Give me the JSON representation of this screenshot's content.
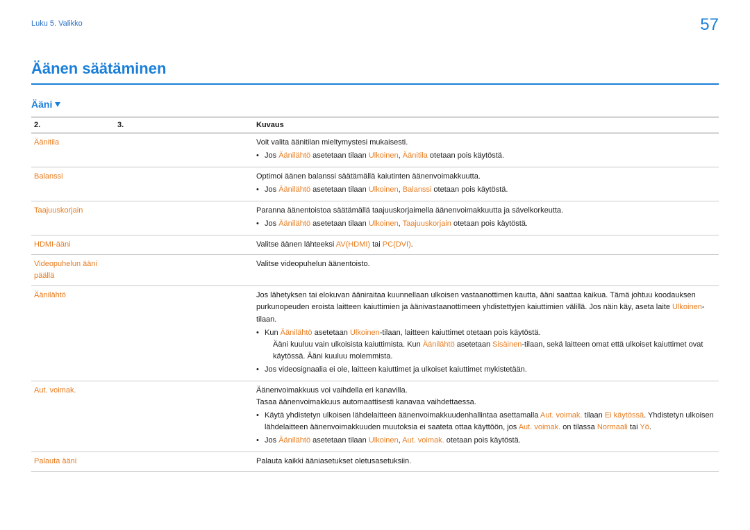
{
  "breadcrumb": "Luku 5. Valikko",
  "pageNumber": "57",
  "title": "Äänen säätäminen",
  "subsection": "Ääni",
  "headers": {
    "c1": "2.",
    "c2": "3.",
    "c3": "Kuvaus"
  },
  "rows": {
    "aanitila": {
      "label": "Äänitila",
      "p1": "Voit valita äänitilan mieltymystesi mukaisesti.",
      "b1a": "Jos ",
      "b1b": " asetetaan tilaan ",
      "b1c": ", ",
      "b1d": " otetaan pois käytöstä."
    },
    "balanssi": {
      "label": "Balanssi",
      "p1": "Optimoi äänen balanssi säätämällä kaiutinten äänenvoimakkuutta.",
      "b1a": "Jos ",
      "b1b": " asetetaan tilaan ",
      "b1c": ", ",
      "b1d": " otetaan pois käytöstä."
    },
    "taajuus": {
      "label": "Taajuuskorjain",
      "p1": "Paranna äänentoistoa säätämällä taajuuskorjaimella äänenvoimakkuutta ja sävelkorkeutta.",
      "b1a": "Jos ",
      "b1b": " asetetaan tilaan ",
      "b1c": ", ",
      "b1d": " otetaan pois käytöstä."
    },
    "hdmi": {
      "label": "HDMI-ääni",
      "p1a": "Valitse äänen lähteeksi ",
      "p1b": " tai ",
      "p1c": "."
    },
    "videopuhelu": {
      "label": "Videopuhelun ääni päällä",
      "p1": "Valitse videopuhelun äänentoisto."
    },
    "aanilahto": {
      "label": "Äänilähtö",
      "p1": "Jos lähetyksen tai elokuvan ääniraitaa kuunnellaan ulkoisen vastaanottimen kautta, ääni saattaa kaikua. Tämä johtuu koodauksen purkunopeuden eroista laitteen kaiuttimien ja äänivastaanottimeen yhdistettyjen kaiuttimien välillä. Jos näin käy, aseta laite ",
      "p1b": "-tilaan.",
      "b1a": "Kun ",
      "b1b": " asetetaan ",
      "b1c": "-tilaan, laitteen kaiuttimet otetaan pois käytöstä.",
      "b1n": "Ääni kuuluu vain ulkoisista kaiuttimista. Kun ",
      "b1n2": " asetetaan ",
      "b1n3": "-tilaan, sekä laitteen omat että ulkoiset kaiuttimet ovat käytössä. Ääni kuuluu molemmista.",
      "b2": "Jos videosignaalia ei ole, laitteen kaiuttimet ja ulkoiset kaiuttimet mykistetään."
    },
    "autvoimak": {
      "label": "Aut. voimak.",
      "p1": "Äänenvoimakkuus voi vaihdella eri kanavilla.",
      "p2": "Tasaa äänenvoimakkuus automaattisesti kanavaa vaihdettaessa.",
      "b1a": "Käytä yhdistetyn ulkoisen lähdelaitteen äänenvoimakkuudenhallintaa asettamalla ",
      "b1b": " tilaan ",
      "b1c": ". Yhdistetyn ulkoisen lähdelaitteen äänenvoimakkuuden muutoksia ei saateta ottaa käyttöön, jos ",
      "b1d": " on tilassa ",
      "b1e": " tai ",
      "b1f": ".",
      "b2a": "Jos ",
      "b2b": " asetetaan tilaan ",
      "b2c": ", ",
      "b2d": " otetaan pois käytöstä."
    },
    "palauta": {
      "label": "Palauta ääni",
      "p1": "Palauta kaikki ääniasetukset oletusasetuksiin."
    }
  },
  "kw": {
    "Aanilahto": "Äänilähtö",
    "Ulkoinen": "Ulkoinen",
    "Aanitila": "Äänitila",
    "Balanssi": "Balanssi",
    "Taajuuskorjain": "Taajuuskorjain",
    "AVHDMI": "AV(HDMI)",
    "PCDVI": "PC(DVI)",
    "Sisainen": "Sisäinen",
    "AutVoimak": "Aut. voimak.",
    "EiKaytossa": "Ei käytössä",
    "Normaali": "Normaali",
    "Yo": "Yö"
  }
}
